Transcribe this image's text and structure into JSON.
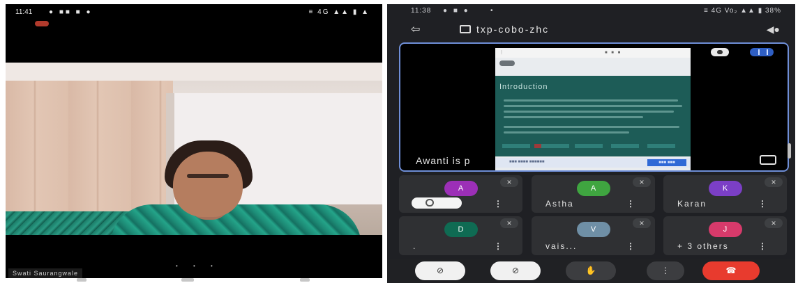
{
  "left_screen": {
    "status_time": "11:41",
    "status_icons": "● ■■ ■ ●",
    "status_right": "≡ 4G ▲▲ ▮ ▲",
    "participant_name": "Swati Saurangwale",
    "pager_dots": "• • •"
  },
  "right_screen": {
    "status_time": "11:38",
    "status_icons": "● ■ ●",
    "status_dot": "•",
    "status_right": "≡ 4G Vo₂ ▲▲ ▮ 38%",
    "meeting_code": "txp-cobo-zhc",
    "back_glyph": "⇦",
    "speaker_glyph": "◀●",
    "share": {
      "doc_heading": "Introduction",
      "presenter_label": "Awanti is p",
      "bottom_button": "■■■ ■■■",
      "bottom_label": "■■■ ■■■■ ■■■■■■"
    },
    "participants": [
      {
        "initial": "A",
        "label": "",
        "color": "#9c2fb7",
        "self": true
      },
      {
        "initial": "A",
        "label": "Astha",
        "color": "#3fa540",
        "self": false
      },
      {
        "initial": "K",
        "label": "Karan",
        "color": "#7b3fc6",
        "self": false
      },
      {
        "initial": "D",
        "label": ".",
        "color": "#0f6b53",
        "self": false
      },
      {
        "initial": "V",
        "label": "vais...",
        "color": "#6f8fa6",
        "self": false
      },
      {
        "initial": "J",
        "label": "+ 3 others",
        "color": "#d73a6b",
        "self": false
      }
    ],
    "tile_menu_glyph": "⋮",
    "tile_mute_glyph": "✕",
    "controls": {
      "camera": "⊘",
      "mic": "⊘",
      "hand": "✋",
      "more": "⋮",
      "hangup": "☎"
    }
  }
}
